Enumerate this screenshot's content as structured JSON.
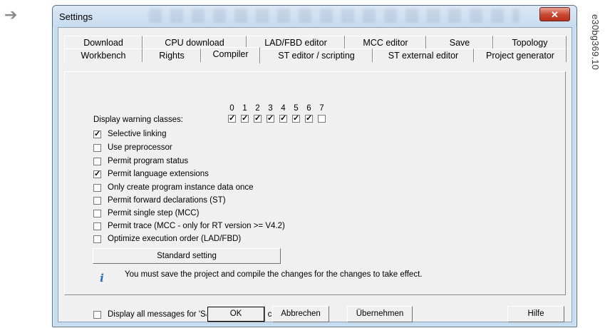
{
  "doc": {
    "arrow": "➔",
    "reference": "e30bg369.10"
  },
  "window": {
    "title": "Settings",
    "close_glyph": "✕"
  },
  "tabs_back": [
    "Download",
    "CPU download",
    "LAD/FBD editor",
    "MCC editor",
    "Save",
    "Topology"
  ],
  "tabs_front": [
    "Workbench",
    "Rights",
    "Compiler",
    "ST editor / scripting",
    "ST external editor",
    "Project generator"
  ],
  "active_tab": "Compiler",
  "warnings": {
    "label": "Display warning classes:",
    "classes": [
      {
        "num": "0",
        "checked": true
      },
      {
        "num": "1",
        "checked": true
      },
      {
        "num": "2",
        "checked": true
      },
      {
        "num": "3",
        "checked": true
      },
      {
        "num": "4",
        "checked": true
      },
      {
        "num": "5",
        "checked": true
      },
      {
        "num": "6",
        "checked": true
      },
      {
        "num": "7",
        "checked": false
      }
    ]
  },
  "options": [
    {
      "label": "Selective linking",
      "checked": true
    },
    {
      "label": "Use preprocessor",
      "checked": false
    },
    {
      "label": "Permit program status",
      "checked": false
    },
    {
      "label": "Permit language extensions",
      "checked": true
    },
    {
      "label": "Only create program instance data once",
      "checked": false
    },
    {
      "label": "Permit forward declarations (ST)",
      "checked": false
    },
    {
      "label": "Permit single step (MCC)",
      "checked": false
    },
    {
      "label": "Permit trace (MCC - only for RT version >= V4.2)",
      "checked": false
    },
    {
      "label": "Optimize execution order (LAD/FBD)",
      "checked": false
    }
  ],
  "standard_button": "Standard setting",
  "info_icon": "i",
  "info_text": "You must save the project and compile the changes for the changes to take effect.",
  "display_all": {
    "label": "Display all messages for 'Save and compile changes'",
    "checked": false
  },
  "buttons": {
    "ok": "OK",
    "cancel": "Abbrechen",
    "apply": "Übernehmen",
    "help": "Hilfe"
  },
  "check_glyph": "✓"
}
